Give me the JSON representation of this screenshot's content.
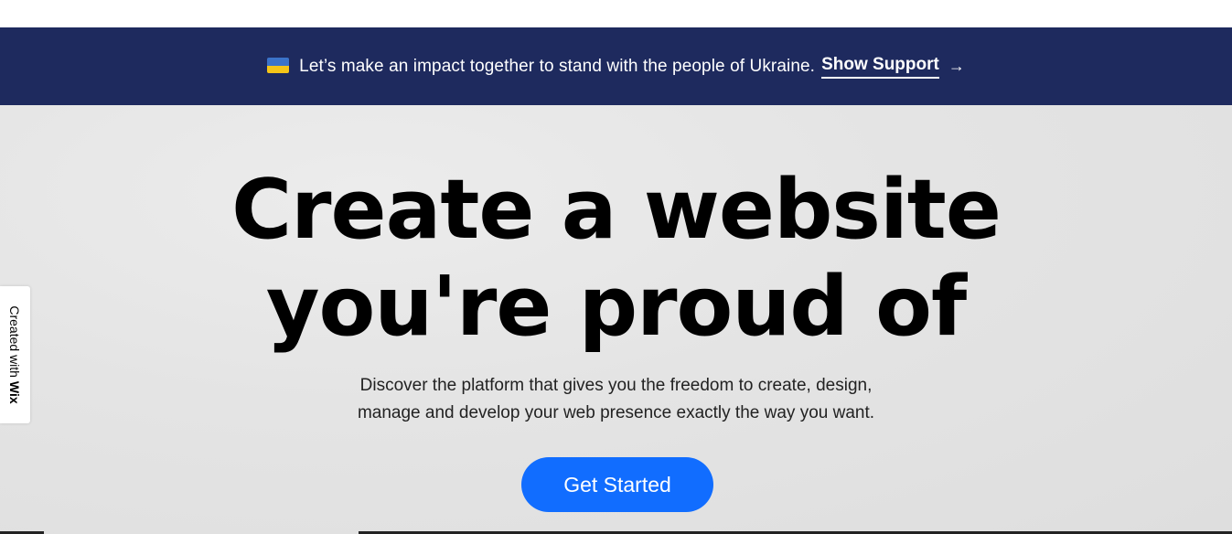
{
  "banner": {
    "flag_icon": "ukraine-flag-icon",
    "message": "Let’s make an impact together to stand with the people of Ukraine.",
    "link_label": "Show Support",
    "arrow": "→",
    "background_color": "#1e2a5e"
  },
  "hero": {
    "headline_line1": "Create a website",
    "headline_line2": "you're proud of",
    "subtext_line1": "Discover the platform that gives you the freedom to create, design,",
    "subtext_line2": "manage and develop your web presence exactly the way you want.",
    "cta_label": "Get Started",
    "cta_color": "#116dff"
  },
  "wix_badge": {
    "prefix": "Created with",
    "brand": "Wix"
  }
}
